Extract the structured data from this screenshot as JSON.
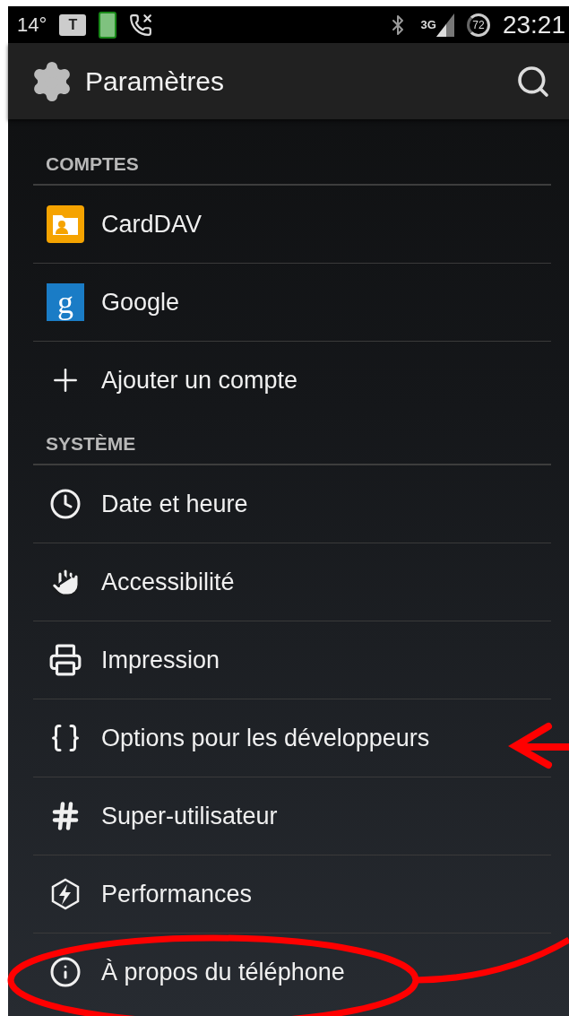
{
  "status_bar": {
    "temperature": "14°",
    "notification_letter": "T",
    "network": "3G",
    "battery": "72",
    "time": "23:21"
  },
  "action_bar": {
    "title": "Paramètres"
  },
  "sections": [
    {
      "header": "COMPTES",
      "items": [
        {
          "label": "CardDAV"
        },
        {
          "label": "Google",
          "badge": "g"
        },
        {
          "label": "Ajouter un compte"
        }
      ]
    },
    {
      "header": "SYSTÈME",
      "items": [
        {
          "label": "Date et heure"
        },
        {
          "label": "Accessibilité"
        },
        {
          "label": "Impression"
        },
        {
          "label": "Options pour les développeurs"
        },
        {
          "label": "Super-utilisateur"
        },
        {
          "label": "Performances"
        },
        {
          "label": "À propos du téléphone"
        }
      ]
    }
  ]
}
